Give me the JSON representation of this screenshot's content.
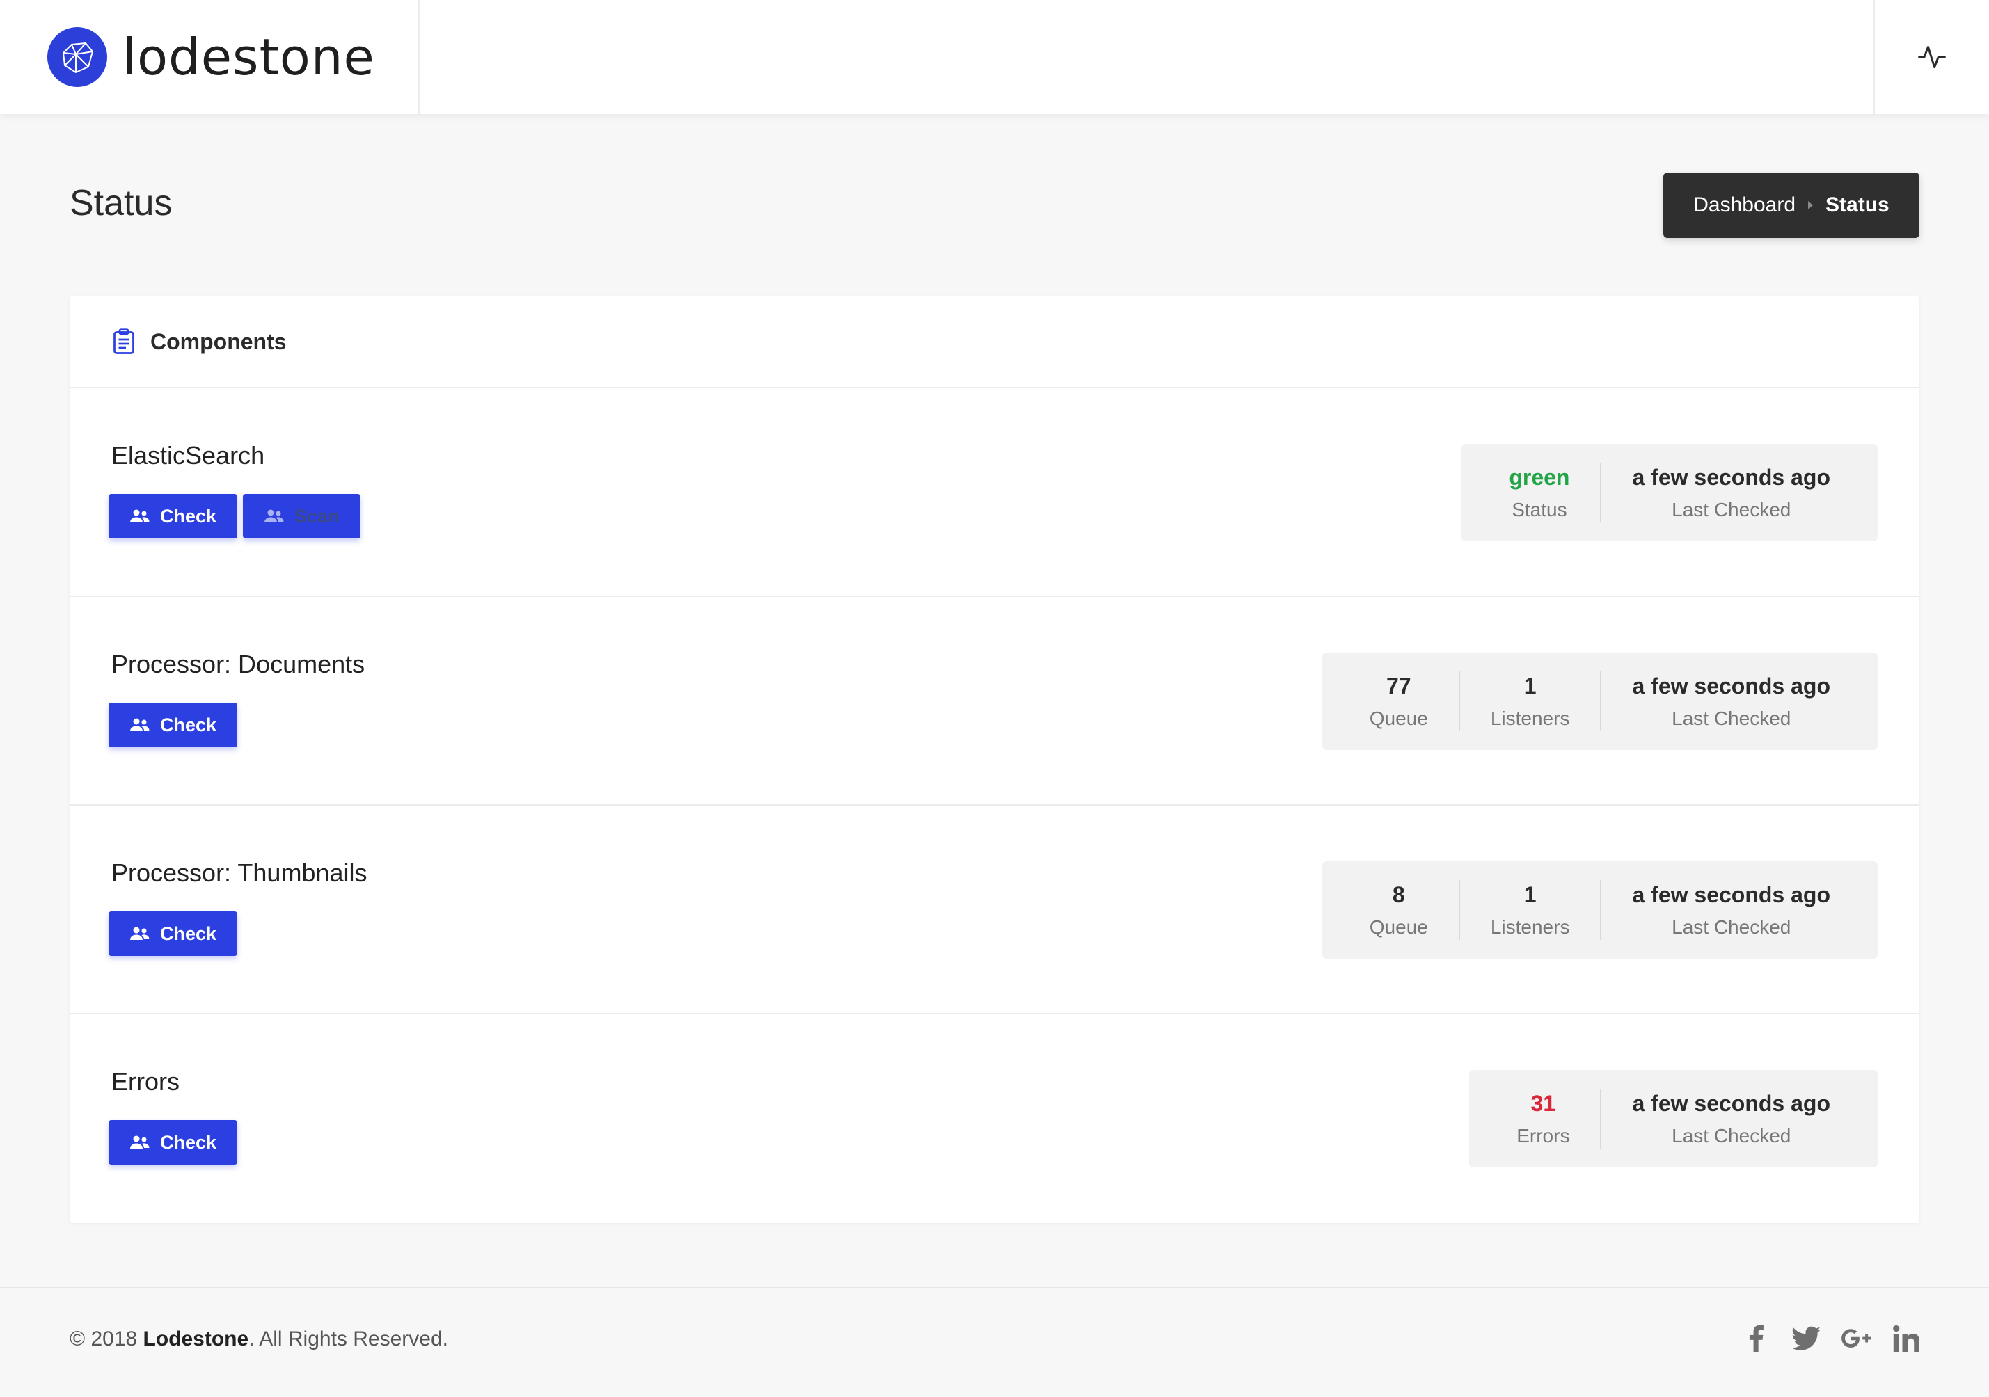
{
  "header": {
    "brand_name": "lodestone",
    "logo_icon": "lodestone-gem-icon",
    "action_icon": "activity-pulse-icon"
  },
  "page": {
    "title": "Status",
    "breadcrumb": [
      "Dashboard",
      "Status"
    ]
  },
  "card": {
    "icon": "clipboard-icon",
    "title": "Components"
  },
  "components": [
    {
      "name": "ElasticSearch",
      "buttons": [
        {
          "label": "Check",
          "disabled": false
        },
        {
          "label": "Scan",
          "disabled": true
        }
      ],
      "stats": [
        {
          "value": "green",
          "label": "Status",
          "color": "#22a447"
        },
        {
          "value": "a few seconds ago",
          "label": "Last Checked"
        }
      ]
    },
    {
      "name": "Processor: Documents",
      "buttons": [
        {
          "label": "Check",
          "disabled": false
        }
      ],
      "stats": [
        {
          "value": "77",
          "label": "Queue"
        },
        {
          "value": "1",
          "label": "Listeners"
        },
        {
          "value": "a few seconds ago",
          "label": "Last Checked"
        }
      ]
    },
    {
      "name": "Processor: Thumbnails",
      "buttons": [
        {
          "label": "Check",
          "disabled": false
        }
      ],
      "stats": [
        {
          "value": "8",
          "label": "Queue"
        },
        {
          "value": "1",
          "label": "Listeners"
        },
        {
          "value": "a few seconds ago",
          "label": "Last Checked"
        }
      ]
    },
    {
      "name": "Errors",
      "buttons": [
        {
          "label": "Check",
          "disabled": false
        }
      ],
      "stats": [
        {
          "value": "31",
          "label": "Errors",
          "color": "#d9283b"
        },
        {
          "value": "a few seconds ago",
          "label": "Last Checked"
        }
      ]
    }
  ],
  "footer": {
    "copyright_prefix": "© 2018 ",
    "company": "Lodestone",
    "copyright_suffix": ". All Rights Reserved.",
    "social": [
      "facebook-icon",
      "twitter-icon",
      "google-plus-icon",
      "linkedin-icon"
    ]
  },
  "colors": {
    "accent": "#2c3fe0",
    "status_green": "#22a447",
    "error_red": "#d9283b",
    "breadcrumb_bg": "#2f2f2f"
  }
}
